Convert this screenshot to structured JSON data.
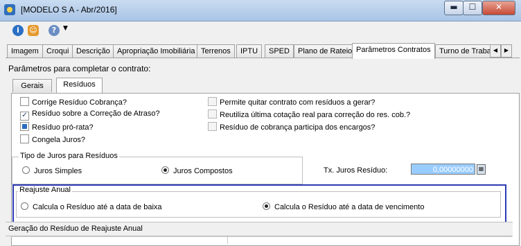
{
  "window": {
    "title": "[MODELO S A - Abr/2016]",
    "buttons": {
      "minimize": "▬",
      "maximize": "☐",
      "close": "✕"
    }
  },
  "toolbar": {
    "icons": [
      "info-icon",
      "user-icon",
      "help-icon",
      "dropdown-caret-icon"
    ]
  },
  "tabs": [
    "Imagem",
    "Croqui",
    "Descrição",
    "Apropriação Imobiliária",
    "Terrenos",
    "IPTU",
    "SPED",
    "Plano de Rateio",
    "Parâmetros Contratos",
    "Turno de Traba"
  ],
  "active_tab": "Parâmetros Contratos",
  "section_title": "Parâmetros para completar o contrato:",
  "subtabs": [
    "Gerais",
    "Resíduos"
  ],
  "active_subtab": "Resíduos",
  "checkboxes_left": [
    {
      "label": "Corrige Resíduo Cobrança?",
      "state": "unchecked"
    },
    {
      "label": "Resíduo sobre a Correção de Atraso?",
      "state": "checked"
    },
    {
      "label": "Resíduo pró-rata?",
      "state": "indeterminate"
    },
    {
      "label": "Congela Juros?",
      "state": "unchecked"
    }
  ],
  "checkboxes_right": [
    {
      "label": "Permite quitar contrato com resíduos a gerar?",
      "state": "unchecked"
    },
    {
      "label": "Reutiliza última cotação real para correção do res. cob.?",
      "state": "unchecked"
    },
    {
      "label": "Resíduo de cobrança participa dos encargos?",
      "state": "unchecked"
    }
  ],
  "juros_group": {
    "legend": "Tipo de Juros para Resíduos",
    "options": [
      "Juros Simples",
      "Juros Compostos"
    ],
    "selected": "Juros Compostos"
  },
  "taxa": {
    "label": "Tx. Juros Resíduo:",
    "value": "0,00000000"
  },
  "reajuste_group": {
    "legend": "Reajuste Anual",
    "options": [
      "Calcula o Resíduo até a data de baixa",
      "Calcula o Resíduo até a data de vencimento"
    ],
    "selected": "Calcula o Resíduo até a data de vencimento"
  },
  "geracao": {
    "title": "Geração do Resíduo de Reajuste Anual"
  },
  "colors": {
    "highlight_border": "#2d3ab3",
    "input_selected_bg": "#99ccff"
  }
}
